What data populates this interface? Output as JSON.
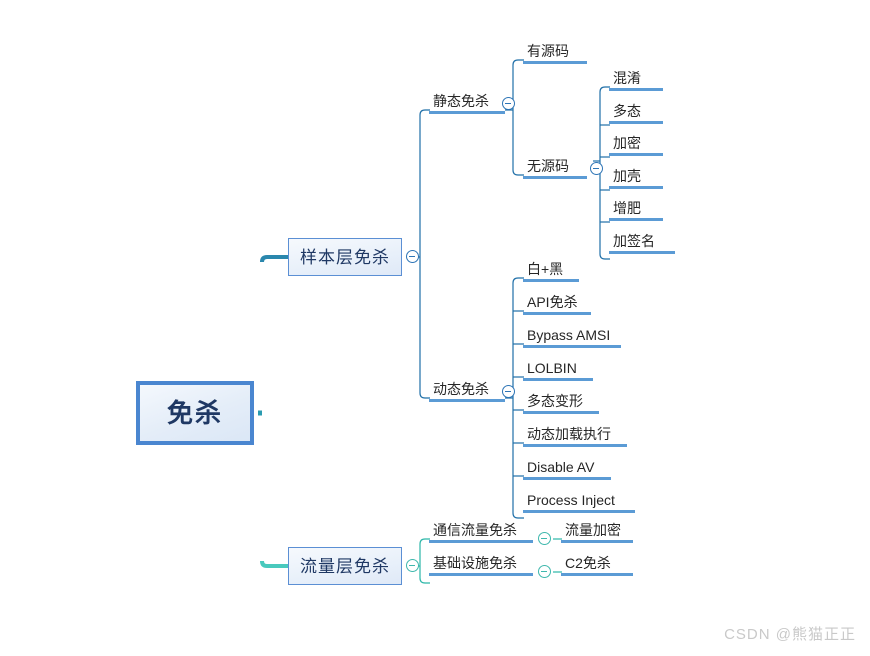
{
  "diagram": {
    "title": "免杀",
    "watermark": "CSDN @熊猫正正",
    "colors": {
      "root_border": "#4a86d0",
      "root_fill": "#e4edf8",
      "node_border": "#5b8fd4",
      "underline": "#5b9bd5",
      "wire_blue": "#1f6fa8",
      "wire_teal": "#2bb6a8",
      "collapse_blue": "#2e75b6",
      "collapse_teal": "#3fb8ad",
      "text_dark": "#1f3864",
      "text_body": "#262626",
      "watermark": "#c9c9c9"
    }
  },
  "root": {
    "label": "免杀"
  },
  "branches": [
    {
      "id": "sample-layer",
      "label": "样本层免杀",
      "collapse_icon": "collapse-minus-icon",
      "children": [
        {
          "id": "static-evasion",
          "label": "静态免杀",
          "collapse_icon": "collapse-minus-icon",
          "children": [
            {
              "id": "with-source",
              "label": "有源码",
              "children": []
            },
            {
              "id": "no-source",
              "label": "无源码",
              "collapse_icon": "collapse-minus-icon",
              "children": [
                {
                  "id": "obfuscation",
                  "label": "混淆"
                },
                {
                  "id": "polymorphism",
                  "label": "多态"
                },
                {
                  "id": "encryption",
                  "label": "加密"
                },
                {
                  "id": "packing",
                  "label": "加壳"
                },
                {
                  "id": "fattening",
                  "label": "增肥"
                },
                {
                  "id": "signing",
                  "label": "加签名"
                }
              ]
            }
          ]
        },
        {
          "id": "dynamic-evasion",
          "label": "动态免杀",
          "collapse_icon": "collapse-minus-icon",
          "children": [
            {
              "id": "white-black",
              "label": "白+黑"
            },
            {
              "id": "api-evasion",
              "label": "API免杀"
            },
            {
              "id": "bypass-amsi",
              "label": "Bypass AMSI"
            },
            {
              "id": "lolbin",
              "label": "LOLBIN"
            },
            {
              "id": "polymorphic-mutation",
              "label": "多态变形"
            },
            {
              "id": "dynamic-load-exec",
              "label": "动态加载执行"
            },
            {
              "id": "disable-av",
              "label": "Disable AV"
            },
            {
              "id": "process-inject",
              "label": "Process Inject"
            }
          ]
        }
      ]
    },
    {
      "id": "traffic-layer",
      "label": "流量层免杀",
      "collapse_icon": "collapse-minus-icon",
      "children": [
        {
          "id": "comm-traffic-evasion",
          "label": "通信流量免杀",
          "collapse_icon": "collapse-minus-icon",
          "children": [
            {
              "id": "traffic-encryption",
              "label": "流量加密"
            }
          ]
        },
        {
          "id": "infra-evasion",
          "label": "基础设施免杀",
          "collapse_icon": "collapse-minus-icon",
          "children": [
            {
              "id": "c2-evasion",
              "label": "C2免杀"
            }
          ]
        }
      ]
    }
  ]
}
